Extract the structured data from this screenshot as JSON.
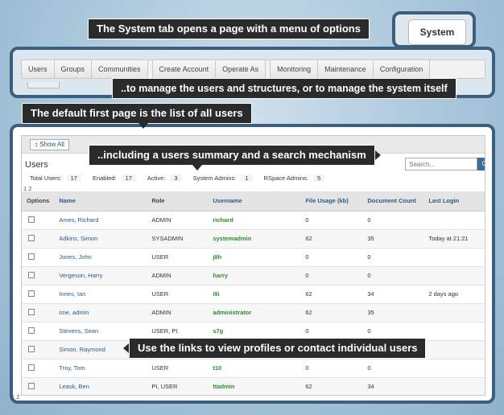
{
  "callouts": {
    "system_tab": "The System tab opens a page with a menu of options",
    "manage": "..to manage the users and structures, or to manage the system itself",
    "default_page": "The default first page is the list of all users",
    "summary": "..including a users summary and a search mechanism",
    "links": "Use the links to view profiles or contact individual users"
  },
  "system_tab": {
    "label": "System"
  },
  "menu": {
    "items": [
      "Users",
      "Groups",
      "Communities",
      "Create Account",
      "Operate As",
      "Monitoring",
      "Maintenance",
      "Configuration"
    ]
  },
  "toolbar": {
    "show_all": "Show All"
  },
  "users_page": {
    "title": "Users",
    "search": {
      "placeholder": "Search...",
      "go": "Go"
    },
    "summary": [
      {
        "label": "Total Users:",
        "value": "17"
      },
      {
        "label": "Enabled:",
        "value": "17"
      },
      {
        "label": "Active:",
        "value": "3"
      },
      {
        "label": "System Admins:",
        "value": "1"
      },
      {
        "label": "RSpace Admins:",
        "value": "5"
      }
    ],
    "pager": "1 2",
    "bottom_pager": "1 2"
  },
  "table": {
    "headers": [
      "Options",
      "Name",
      "Role",
      "Username",
      "File Usage (kb)",
      "Document Count",
      "Last Login"
    ],
    "rows": [
      {
        "name": "Ames, Richard",
        "role": "ADMIN",
        "username": "richard",
        "usage": "0",
        "docs": "0",
        "last_login": ""
      },
      {
        "name": "Adkins, Simon",
        "role": "SYSADMIN",
        "username": "systemadmin",
        "usage": "62",
        "docs": "35",
        "last_login": "Today at 21:21"
      },
      {
        "name": "Jones, John",
        "role": "USER",
        "username": "j8h",
        "usage": "0",
        "docs": "0",
        "last_login": ""
      },
      {
        "name": "Vergeson, Harry",
        "role": "ADMIN",
        "username": "harry",
        "usage": "0",
        "docs": "0",
        "last_login": ""
      },
      {
        "name": "Innes, Ian",
        "role": "USER",
        "username": "i9i",
        "usage": "62",
        "docs": "34",
        "last_login": "2 days ago"
      },
      {
        "name": "one, admin",
        "role": "ADMIN",
        "username": "administrator",
        "usage": "62",
        "docs": "35",
        "last_login": ""
      },
      {
        "name": "Stevens, Sean",
        "role": "USER, PI",
        "username": "s7g",
        "usage": "0",
        "docs": "0",
        "last_login": ""
      },
      {
        "name": "Simon, Raymond",
        "role": "",
        "username": "",
        "usage": "",
        "docs": "",
        "last_login": ""
      },
      {
        "name": "Troy, Tom",
        "role": "USER",
        "username": "t10",
        "usage": "0",
        "docs": "0",
        "last_login": ""
      },
      {
        "name": "Leask, Ben",
        "role": "PI, USER",
        "username": "ttadmin",
        "usage": "62",
        "docs": "34",
        "last_login": ""
      }
    ]
  },
  "colors": {
    "frame": "#3c5f80",
    "callout_bg": "#2b2b2b",
    "link": "#2a5b8a",
    "username": "#2e8b2e",
    "go_button": "#3f6e99"
  }
}
